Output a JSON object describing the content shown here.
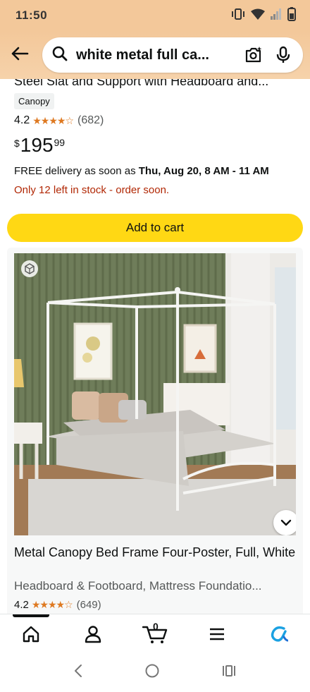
{
  "status": {
    "time": "11:50"
  },
  "search": {
    "query": "white metal full ca..."
  },
  "result1": {
    "title_partial": "Steel Slat and Support with Headboard and...",
    "badge": "Canopy",
    "rating": "4.2",
    "rating_value": 4.2,
    "review_count": "(682)",
    "price_symbol": "$",
    "price_whole": "195",
    "price_fraction": "99",
    "delivery_prefix": "FREE delivery as soon as ",
    "delivery_date": "Thu, Aug 20, 8 AM - 11 AM",
    "stock": "Only 12 left in stock - order soon.",
    "add_to_cart": "Add to cart"
  },
  "result2": {
    "title": "Metal Canopy Bed Frame Four-Poster, Full, White",
    "subtitle": "Headboard & Footboard, Mattress Foundatio...",
    "rating": "4.2",
    "rating_value": 4.2,
    "review_count": "(649)",
    "image_alt": "White metal canopy bed in green-paneled bedroom"
  },
  "bottom_nav": {
    "cart_count": "0",
    "items": [
      "home-icon",
      "account-icon",
      "cart-icon",
      "menu-icon",
      "rufus-icon"
    ]
  },
  "system_nav": {
    "items": [
      "back-icon",
      "home-circle-icon",
      "recents-icon"
    ]
  },
  "colors": {
    "header_bg": "#f3c89a",
    "add_to_cart_bg": "#ffd814",
    "star": "#de7921",
    "stock_red": "#b12704",
    "rufus_blue": "#1ba1e2"
  }
}
